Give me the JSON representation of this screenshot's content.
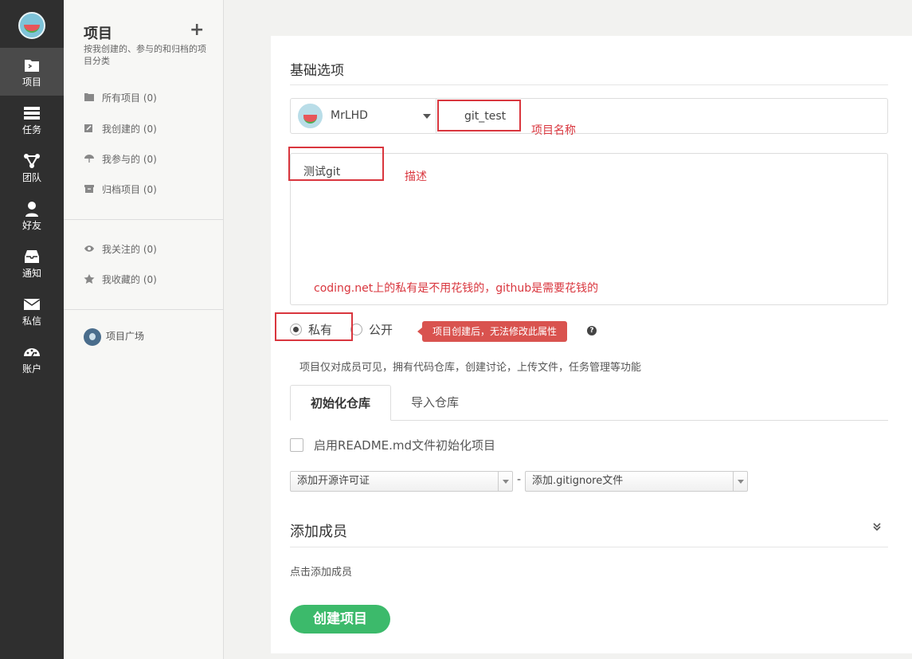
{
  "rail": {
    "items": [
      {
        "label": "项目",
        "icon": "folder-icon"
      },
      {
        "label": "任务",
        "icon": "tasks-icon"
      },
      {
        "label": "团队",
        "icon": "team-icon"
      },
      {
        "label": "好友",
        "icon": "user-icon"
      },
      {
        "label": "通知",
        "icon": "inbox-icon"
      },
      {
        "label": "私信",
        "icon": "envelope-icon"
      },
      {
        "label": "账户",
        "icon": "dashboard-icon"
      }
    ]
  },
  "sidebar": {
    "title": "项目",
    "add_symbol": "+",
    "description": "按我创建的、参与的和归档的项目分类",
    "items": [
      {
        "label": "所有项目 (0)"
      },
      {
        "label": "我创建的 (0)"
      },
      {
        "label": "我参与的 (0)"
      },
      {
        "label": "归档项目 (0)"
      },
      {
        "label": "我关注的 (0)"
      },
      {
        "label": "我收藏的 (0)"
      }
    ],
    "plaza": "项目广场"
  },
  "form": {
    "section_title": "基础选项",
    "owner": "MrLHD",
    "project_name": "git_test",
    "description": "测试git",
    "visibility": {
      "private_label": "私有",
      "public_label": "公开",
      "selected": "private",
      "tip": "项目创建后，无法修改此属性",
      "note": "项目仅对成员可见，拥有代码仓库，创建讨论，上传文件，任务管理等功能"
    },
    "tabs": [
      {
        "label": "初始化仓库",
        "active": true
      },
      {
        "label": "导入仓库",
        "active": false
      }
    ],
    "readme_label": "启用README.md文件初始化项目",
    "license_select": "添加开源许可证",
    "gitignore_select": "添加.gitignore文件",
    "separator": "-",
    "members_title": "添加成员",
    "add_members_link": "点击添加成员",
    "create_button": "创建项目"
  },
  "annotations": {
    "project_name_note": "项目名称",
    "description_note": "描述",
    "pricing_note": "coding.net上的私有是不用花钱的，github是需要花钱的",
    "color": "#d9363e"
  }
}
